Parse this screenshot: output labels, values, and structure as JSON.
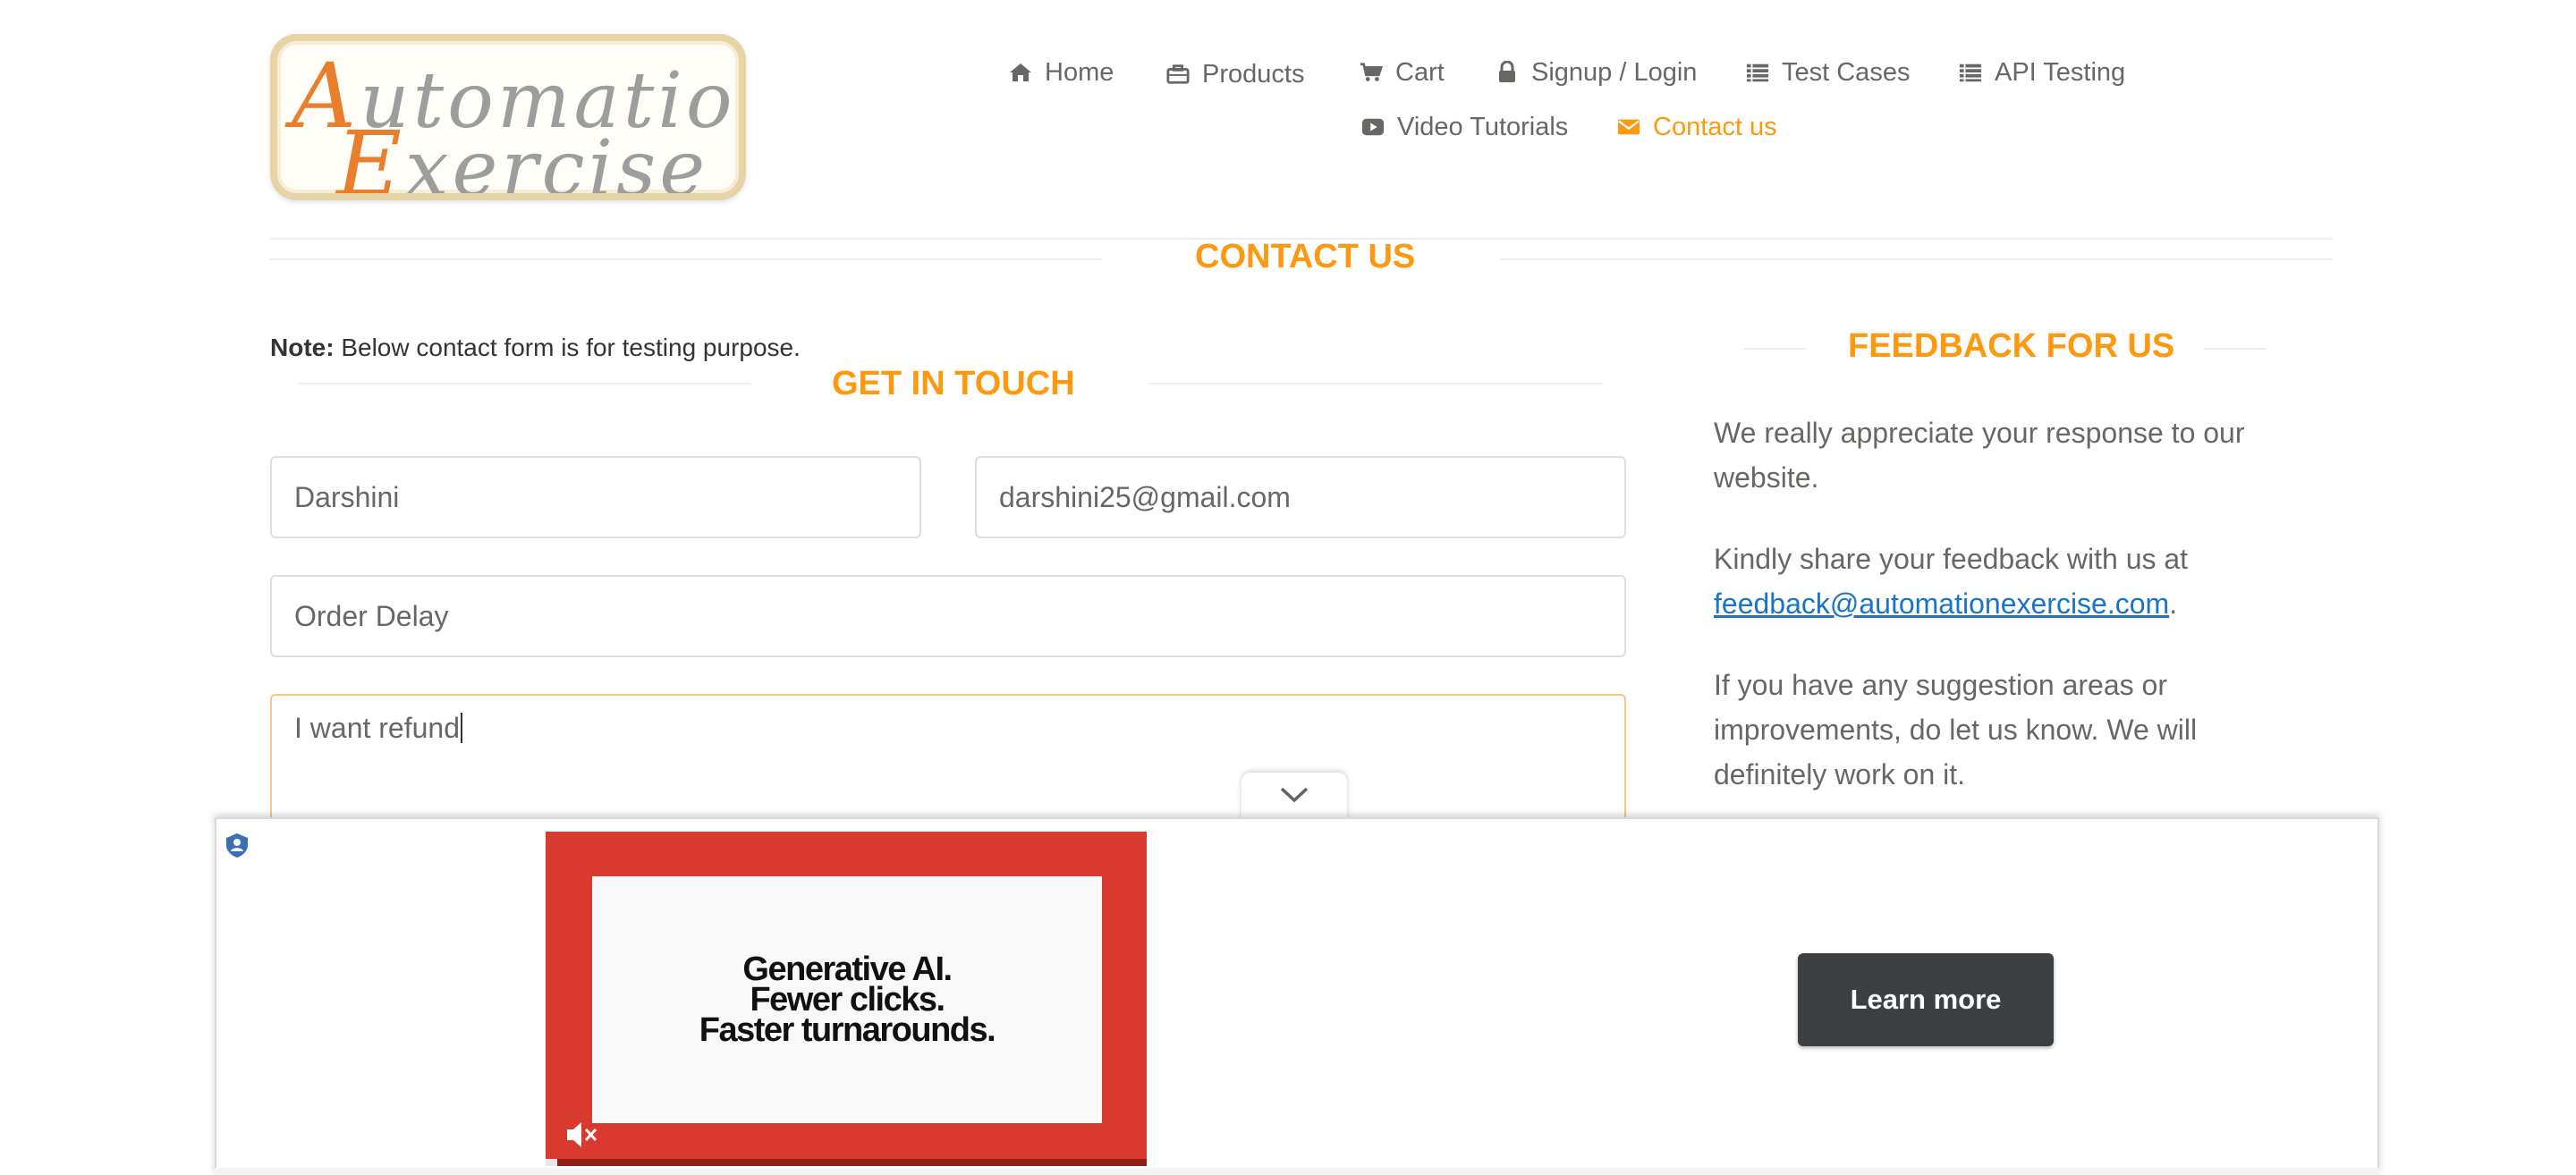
{
  "logo": {
    "line1_cap": "A",
    "line1_rest": "utomation",
    "line2_cap": "E",
    "line2_rest": "xercise"
  },
  "nav": {
    "home": "Home",
    "products": "Products",
    "cart": "Cart",
    "signup": "Signup / Login",
    "test_cases": "Test Cases",
    "api_testing": "API Testing",
    "video_tutorials": "Video Tutorials",
    "contact_us": "Contact us"
  },
  "page_title": "CONTACT US",
  "note": {
    "label": "Note:",
    "text": " Below contact form is for testing purpose."
  },
  "form": {
    "heading": "GET IN TOUCH",
    "name_value": "Darshini",
    "email_value": "darshini25@gmail.com",
    "subject_value": "Order Delay",
    "message_value": "I want refund"
  },
  "feedback": {
    "heading": "FEEDBACK FOR US",
    "p1": "We really appreciate your response to our website.",
    "p2_prefix": "Kindly share your feedback with us at ",
    "p2_email": "feedback@automationexercise.com",
    "p2_suffix": ".",
    "p3": "If you have any suggestion areas or improvements, do let us know. We will definitely work on it."
  },
  "ad": {
    "line1": "Generative AI.",
    "line2": "Fewer clicks.",
    "line3": "Faster turnarounds.",
    "cta": "Learn more",
    "video_progress": 0.02
  },
  "colors": {
    "accent": "#fe980f",
    "text": "#696763",
    "ad_red": "#d93a2f",
    "cta_bg": "#3c4043"
  }
}
